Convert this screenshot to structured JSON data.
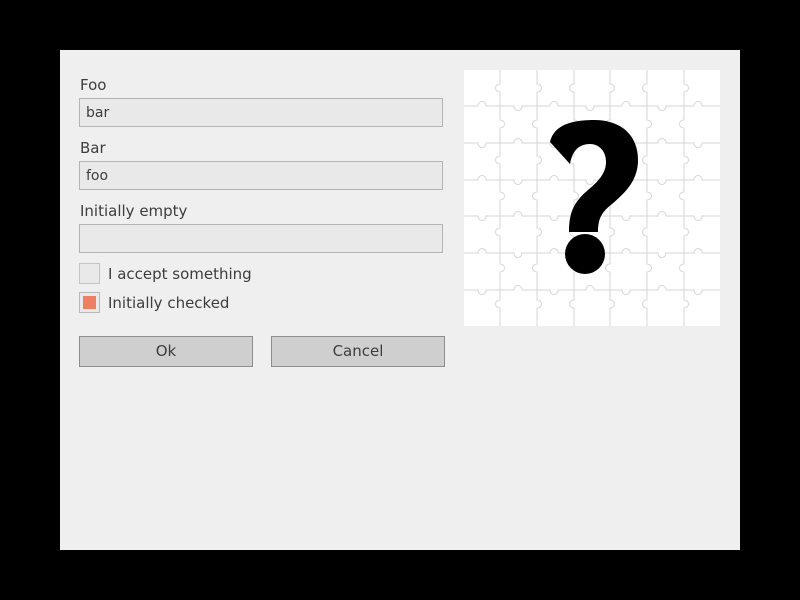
{
  "form": {
    "foo_label": "Foo",
    "foo_value": "bar",
    "bar_label": "Bar",
    "bar_value": "foo",
    "empty_label": "Initially empty",
    "empty_value": "",
    "accept_label": "I accept something",
    "accept_checked": false,
    "checked_label": "Initially checked",
    "checked_checked": true
  },
  "buttons": {
    "ok_label": "Ok",
    "cancel_label": "Cancel"
  },
  "preview": {
    "icon": "question-mark-icon",
    "pattern": "jigsaw-puzzle"
  },
  "colors": {
    "accent": "#ee7f63",
    "background": "#efefef"
  }
}
